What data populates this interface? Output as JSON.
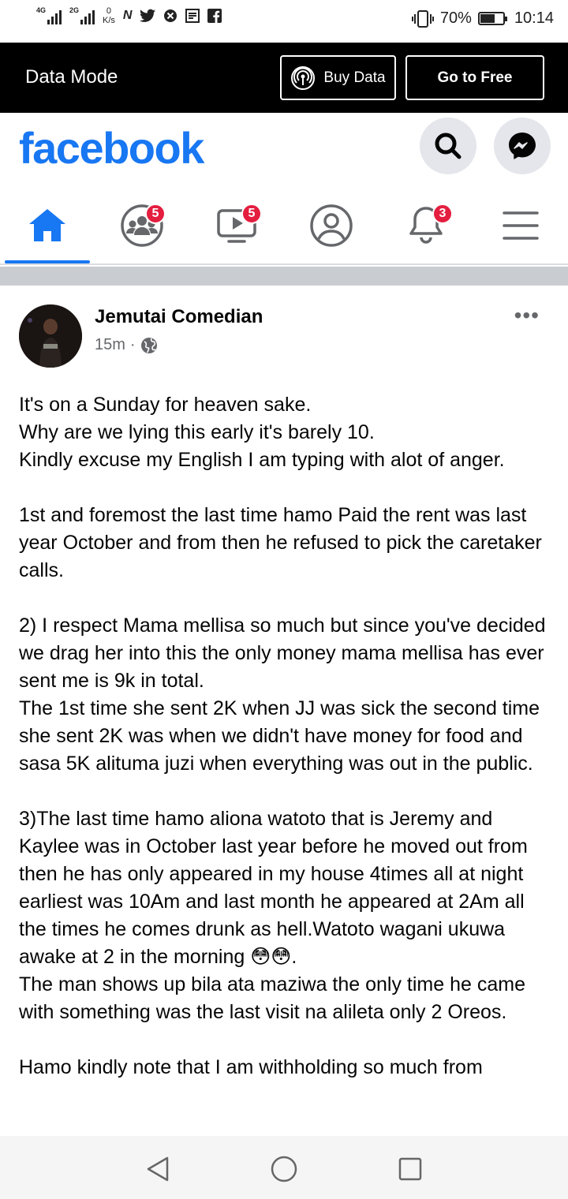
{
  "status_bar": {
    "signal1": "4G",
    "signal2": "2G",
    "speed_value": "0",
    "speed_unit": "K/s",
    "battery": "70%",
    "time": "10:14",
    "battery_level": 0.7
  },
  "data_mode": {
    "title": "Data Mode",
    "buy_label": "Buy Data",
    "free_label": "Go to Free"
  },
  "header": {
    "logo": "facebook",
    "brand_color": "#1877f2"
  },
  "nav": {
    "tabs": [
      {
        "name": "home",
        "icon": "home-icon",
        "badge": ""
      },
      {
        "name": "groups",
        "icon": "groups-icon",
        "badge": "5"
      },
      {
        "name": "watch",
        "icon": "video-icon",
        "badge": "5"
      },
      {
        "name": "profile",
        "icon": "profile-icon",
        "badge": ""
      },
      {
        "name": "notifications",
        "icon": "bell-icon",
        "badge": "3"
      },
      {
        "name": "menu",
        "icon": "menu-icon",
        "badge": ""
      }
    ]
  },
  "post": {
    "author": "Jemutai Comedian",
    "time": "15m",
    "separator": "·",
    "paragraphs": [
      "It's on a Sunday for heaven sake.\nWhy are we lying this early it's barely 10.\nKindly excuse my English I am typing with alot of anger.",
      "1st and foremost the last time hamo Paid the rent was last year October and from then he refused to pick the caretaker calls.",
      "2) I respect Mama mellisa so much but since you've decided we drag her into this the only money mama mellisa has ever sent me is 9k in total.\nThe 1st time she sent 2K when JJ was sick the second time she sent 2K was when we didn't have money for food and sasa 5K alituma juzi when everything was out in the public.",
      "3)The last time hamo aliona watoto that is Jeremy and Kaylee was in October last year before he moved out from then he has only appeared in my house 4times all at night earliest was 10Am and last month he appeared at 2Am all the times he comes drunk as hell.Watoto wagani ukuwa awake at 2 in the morning 😳😳.\nThe man shows up bila ata maziwa the only time he came with something was the last visit na alileta only 2 Oreos.",
      "Hamo kindly note that I am withholding so much from"
    ]
  }
}
